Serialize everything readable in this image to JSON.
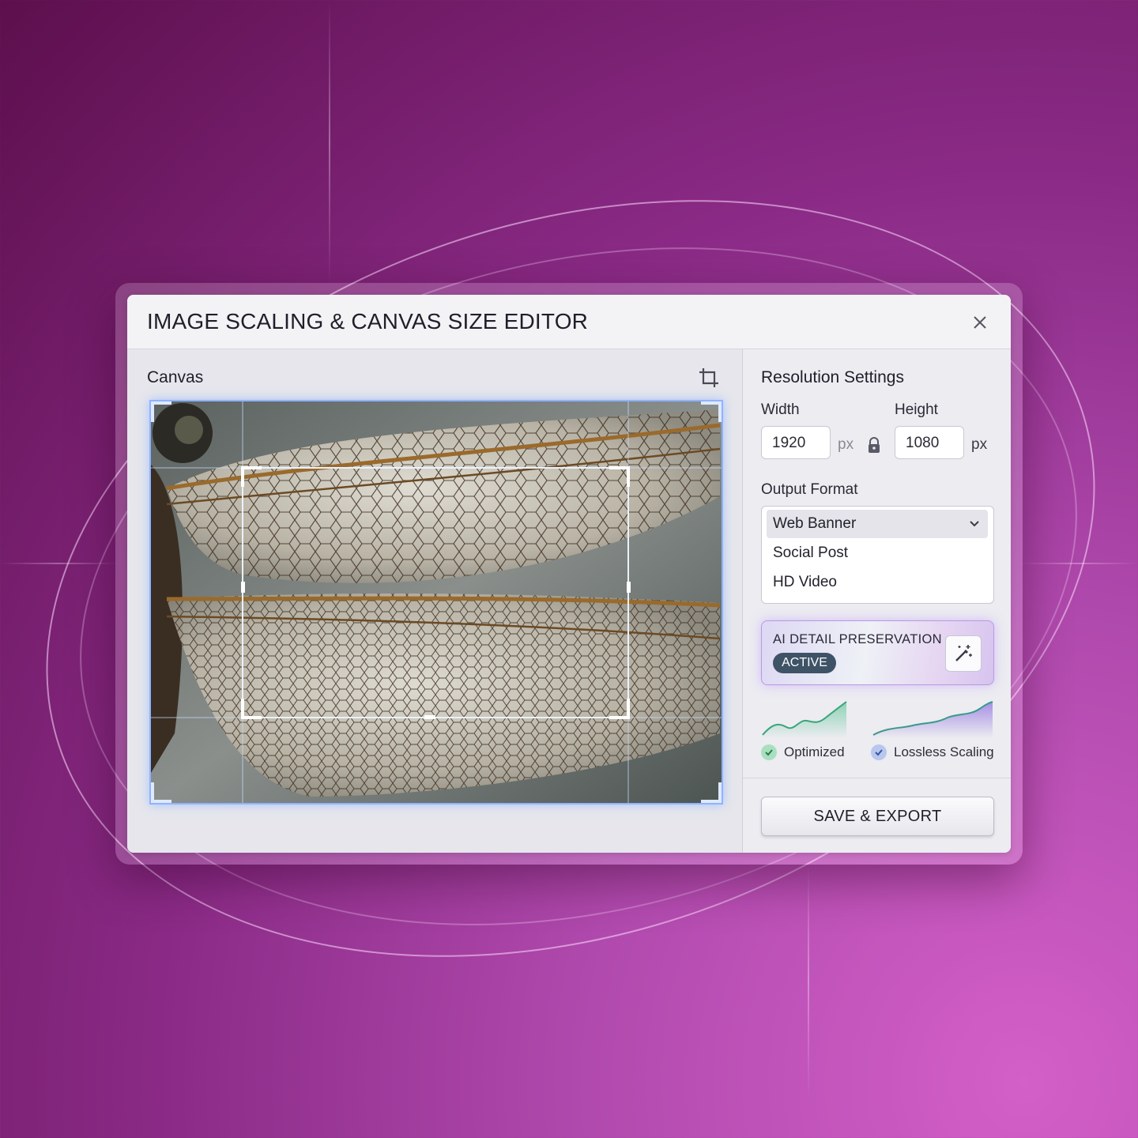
{
  "dialog": {
    "title": "IMAGE SCALING & CANVAS SIZE EDITOR"
  },
  "canvas": {
    "label": "Canvas"
  },
  "resolution": {
    "heading": "Resolution Settings",
    "width_label": "Width",
    "height_label": "Height",
    "width_value": "1920",
    "height_value": "1080",
    "unit_width": "px",
    "unit_height": "px"
  },
  "output_format": {
    "label": "Output Format",
    "options": [
      "Web Banner",
      "Social Post",
      "HD Video"
    ],
    "selected": "Web Banner"
  },
  "ai_detail": {
    "title": "AI DETAIL PRESERVATION",
    "status": "ACTIVE"
  },
  "metrics": {
    "optimized_label": "Optimized",
    "lossless_label": "Lossless Scaling"
  },
  "actions": {
    "save_label": "SAVE & EXPORT"
  },
  "icons": {
    "close": "close-icon",
    "crop": "crop-icon",
    "lock": "lock-icon",
    "chevron": "chevron-down-icon",
    "wand": "magic-wand-icon",
    "check": "check-icon"
  },
  "colors": {
    "accent_blue": "#8fb3ff",
    "badge": "#3e5366",
    "chart_green": "#3aa57a",
    "chart_purple": "#7d62c9"
  }
}
